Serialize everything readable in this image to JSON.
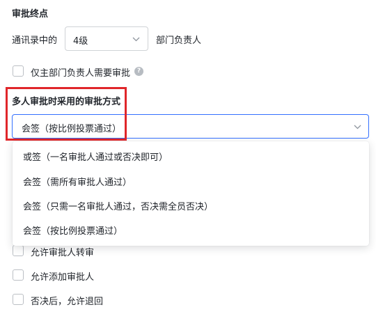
{
  "approval_end": {
    "title": "审批终点",
    "prefix_label": "通讯录中的",
    "level_select_value": "4级",
    "suffix_label": "部门负责人"
  },
  "main_dept_only": {
    "label": "仅主部门负责人需要审批",
    "checked": false,
    "help_icon": "question-circle-icon"
  },
  "multi_approval": {
    "title": "多人审批时采用的审批方式",
    "selected": "会签（按比例投票通过）",
    "options": [
      "或签（一名审批人通过或否决即可）",
      "会签（需所有审批人通过）",
      "会签（只需一名审批人通过，否决需全员否决）",
      "会签（按比例投票通过）"
    ]
  },
  "options_checkboxes": [
    {
      "label": "允许审批人转审",
      "checked": false
    },
    {
      "label": "允许添加审批人",
      "checked": false
    },
    {
      "label": "否决后，允许退回",
      "checked": false
    }
  ],
  "colors": {
    "accent": "#3370ff",
    "highlight_border": "#e0262a",
    "text": "#1f2329"
  }
}
